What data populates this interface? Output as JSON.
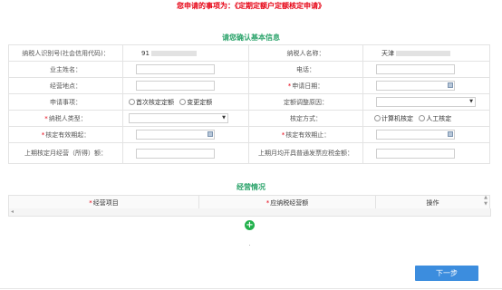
{
  "header": {
    "title": "您申请的事项为：《定期定额户定额核定申请》"
  },
  "basic_info": {
    "title": "请您确认基本信息",
    "taxpayer_id_label": "纳税人识别号(社会信用代码)：",
    "taxpayer_id_value": "91",
    "taxpayer_name_label": "纳税人名称：",
    "taxpayer_name_value": "天津",
    "owner_label": "业主姓名：",
    "phone_label": "电话：",
    "address_label": "经营地点：",
    "apply_date_label": "申请日期：",
    "item_label": "申请事项：",
    "item_options": [
      "首次核定定额",
      "变更定额"
    ],
    "adjust_reason_label": "定额调整原因：",
    "taxpayer_type_label": "纳税人类型：",
    "assess_method_label": "核定方式：",
    "assess_options": [
      "计算机核定",
      "人工核定"
    ],
    "valid_from_label": "核定有效期起：",
    "valid_to_label": "核定有效期止：",
    "prev_revenue_label": "上期核定月经营（所得）额：",
    "prev_invoice_label": "上期月均开具普通发票应税金额："
  },
  "business": {
    "title": "经营情况",
    "columns": [
      "经营项目",
      "应纳税经营额",
      "操作"
    ]
  },
  "footer": {
    "next_label": "下一步"
  },
  "colors": {
    "title_red": "#e60012",
    "section_green": "#2aa36a",
    "button_blue": "#3c8dde",
    "add_green": "#22b14c"
  }
}
